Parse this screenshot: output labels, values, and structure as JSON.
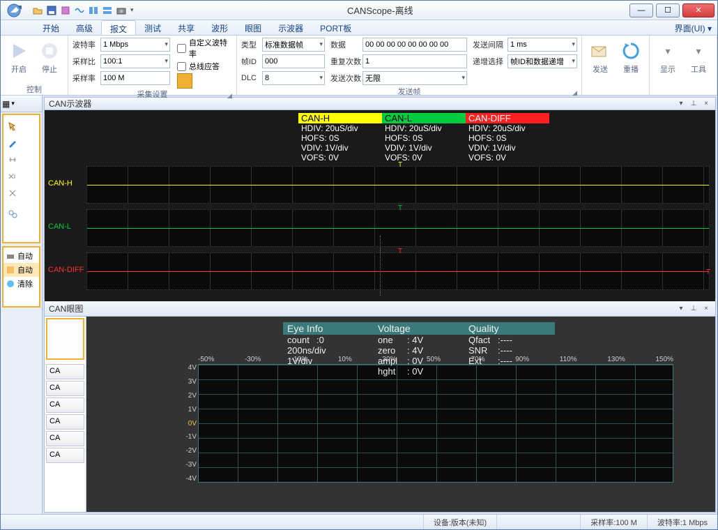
{
  "window": {
    "title": "CANScope-离线"
  },
  "qat": [
    "open",
    "save",
    "settings",
    "table",
    "layout1",
    "layout2",
    "camera"
  ],
  "menu": {
    "tabs": [
      "开始",
      "高级",
      "报文",
      "测试",
      "共享",
      "波形",
      "眼图",
      "示波器",
      "PORT板"
    ],
    "active": 2,
    "right": "界面(UI) ▾"
  },
  "ribbon": {
    "control": {
      "label": "控制",
      "start": "开启",
      "stop": "停止"
    },
    "acquire": {
      "label": "采集设置",
      "baud_lbl": "波特率",
      "baud": "1 Mbps",
      "ratio_lbl": "采样比",
      "ratio": "100:1",
      "rate_lbl": "采样率",
      "rate": "100 M",
      "custom_baud": "自定义波特率",
      "bus_resp": "总线应答"
    },
    "sendfields": {
      "type_lbl": "类型",
      "type": "标准数据帧",
      "id_lbl": "帧ID",
      "id": "000",
      "dlc_lbl": "DLC",
      "dlc": "8",
      "data_lbl": "数据",
      "data": "00 00 00 00 00 00 00 00",
      "repeat_lbl": "重复次数",
      "repeat": "1",
      "sendcnt_lbl": "发送次数",
      "sendcnt": "无限",
      "interval_lbl": "发送间隔",
      "interval": "1 ms",
      "inc_lbl": "递增选择",
      "inc": "帧ID和数据递增"
    },
    "sendgroup_label": "发送帧",
    "send_btn": "发送",
    "repeat_btn": "重播",
    "display_btn": "显示",
    "tools_btn": "工具"
  },
  "scope_panel": {
    "title": "CAN示波器",
    "channels": [
      {
        "name": "CAN-H",
        "color": "y",
        "hdiv": "HDIV: 20uS/div",
        "hofs": "HOFS: 0S",
        "vdiv": "VDIV: 1V/div",
        "vofs": "VOFS: 0V"
      },
      {
        "name": "CAN-L",
        "color": "g",
        "hdiv": "HDIV: 20uS/div",
        "hofs": "HOFS: 0S",
        "vdiv": "VDIV: 1V/div",
        "vofs": "VOFS: 0V"
      },
      {
        "name": "CAN-DIFF",
        "color": "r",
        "hdiv": "HDIV: 20uS/div",
        "hofs": "HOFS: 0S",
        "vdiv": "VDIV: 1V/div",
        "vofs": "VOFS: 0V"
      }
    ]
  },
  "eye_panel": {
    "title": "CAN眼图",
    "tabs": [
      "CA",
      "CA",
      "CA",
      "CA",
      "CA",
      "CA"
    ],
    "info": {
      "eye_title": "Eye Info",
      "count_lbl": "count",
      "count": ":0",
      "hdiv": "200ns/div",
      "vdiv": "1V/div",
      "volt_title": "Voltage",
      "one_lbl": "one",
      "one": ": 4V",
      "zero_lbl": "zero",
      "zero": ": 4V",
      "ampl_lbl": "ampl",
      "ampl": ": 0V",
      "hght_lbl": "hght",
      "hght": ": 0V",
      "q_title": "Quality",
      "qfact_lbl": "Qfact",
      "qfact": ":----",
      "snr_lbl": "SNR",
      "snr": ":----",
      "ext_lbl": "Ext",
      "ext": ":----"
    },
    "xaxis": [
      "-50%",
      "-30%",
      "-10%",
      "10%",
      "30%",
      "50%",
      "70%",
      "90%",
      "110%",
      "130%",
      "150%"
    ],
    "yaxis": [
      "4V",
      "3V",
      "2V",
      "1V",
      "0V",
      "-1V",
      "-2V",
      "-3V",
      "-4V"
    ]
  },
  "left_lower": [
    "自动",
    "自动",
    "清除",
    ""
  ],
  "status": {
    "device": "设备:版本(未知)",
    "rate": "采样率:100 M",
    "baud": "波特率:1 Mbps"
  }
}
